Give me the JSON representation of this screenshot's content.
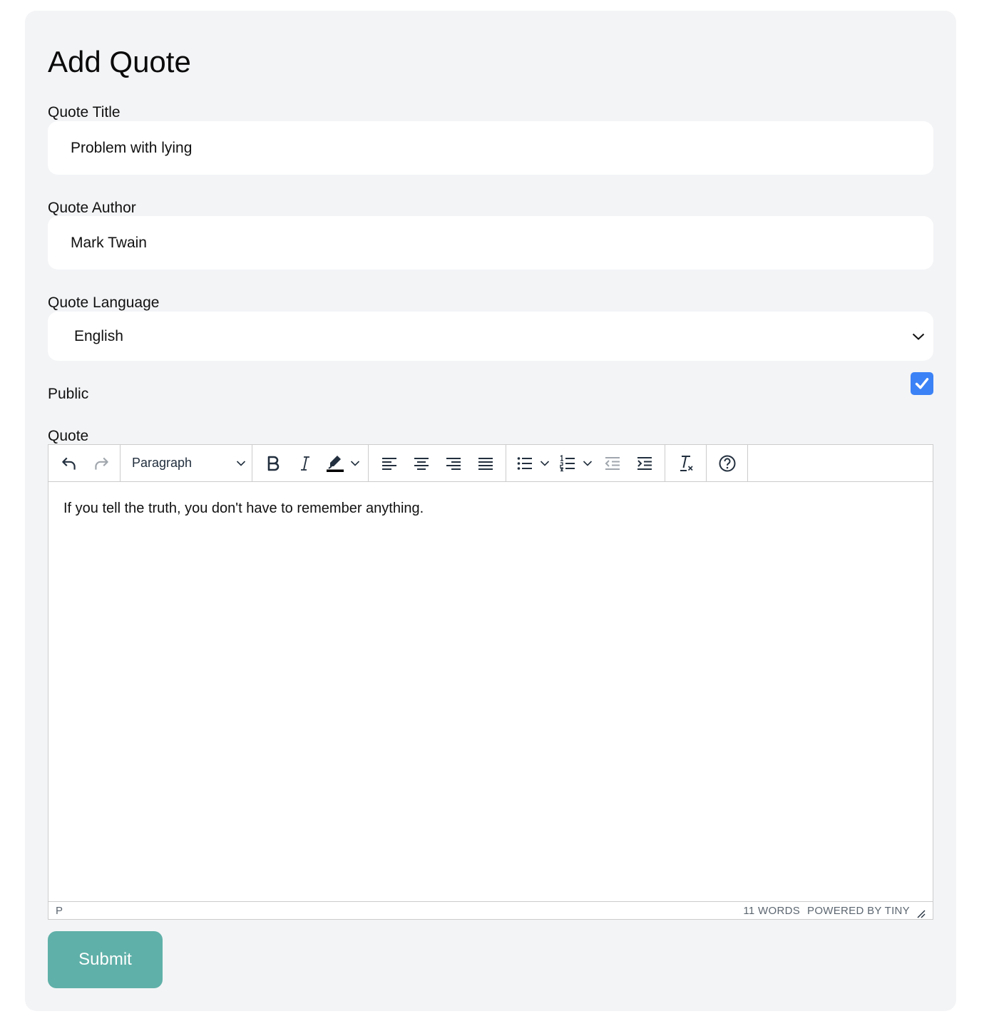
{
  "form": {
    "heading": "Add Quote",
    "title_label": "Quote Title",
    "title_value": "Problem with lying",
    "author_label": "Quote Author",
    "author_value": "Mark Twain",
    "language_label": "Quote Language",
    "language_value": "English",
    "public_label": "Public",
    "public_checked": true,
    "quote_label": "Quote",
    "submit_label": "Submit"
  },
  "editor": {
    "block_format": "Paragraph",
    "content": "If you tell the truth, you don't have to remember anything.",
    "status_path": "P",
    "word_count": "11 WORDS",
    "branding": "POWERED BY TINY"
  },
  "colors": {
    "card_bg": "#f3f4f6",
    "checkbox": "#3b82f6",
    "submit_bg": "#5fb0a8"
  },
  "icons": {
    "toolbar": [
      "undo-icon",
      "redo-icon",
      "bold-icon",
      "italic-icon",
      "highlight-color-icon",
      "align-left-icon",
      "align-center-icon",
      "align-right-icon",
      "align-justify-icon",
      "bullet-list-icon",
      "numbered-list-icon",
      "outdent-icon",
      "indent-icon",
      "clear-formatting-icon",
      "help-icon"
    ]
  }
}
